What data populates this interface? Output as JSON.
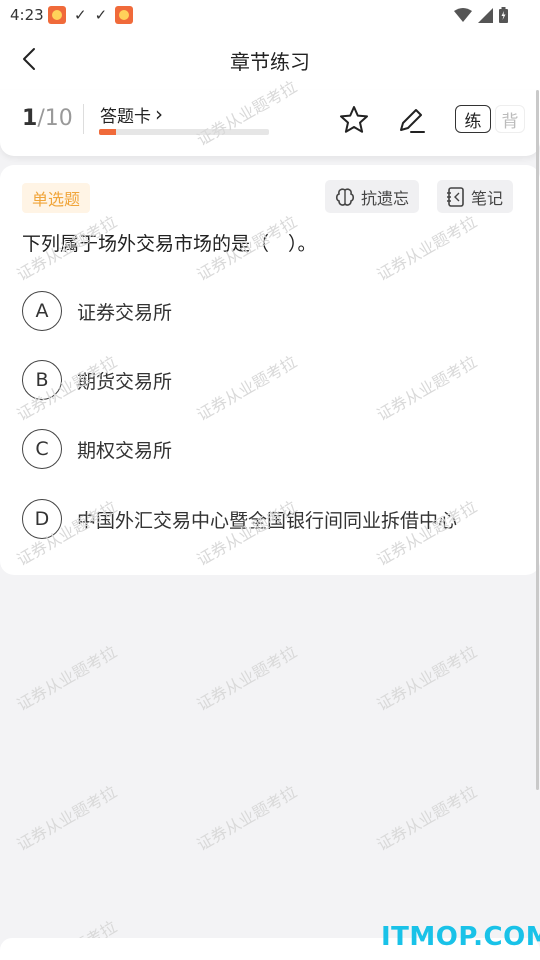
{
  "status_bar": {
    "time": "4:23",
    "notification_icons": [
      "app-icon",
      "download-done-icon",
      "download-done-icon",
      "app-icon"
    ],
    "system_icons": [
      "wifi-icon",
      "signal-icon",
      "battery-icon"
    ]
  },
  "header": {
    "title": "章节练习",
    "back_icon": "chevron-left-icon"
  },
  "progress": {
    "current": "1",
    "total": "/10",
    "answer_card_label": "答题卡",
    "answer_card_arrow": "›",
    "progress_fraction": 0.1,
    "accent_color": "#f06a3a"
  },
  "toolbar": {
    "favorite_icon": "star-icon",
    "edit_icon": "pen-icon",
    "mode_practice": "练",
    "mode_recite": "背"
  },
  "question": {
    "type_label": "单选题",
    "anti_forget_label": "抗遗忘",
    "notes_label": "笔记",
    "text": "下列属于场外交易市场的是（　）。",
    "options": [
      {
        "letter": "A",
        "text": "证券交易所"
      },
      {
        "letter": "B",
        "text": "期货交易所"
      },
      {
        "letter": "C",
        "text": "期权交易所"
      },
      {
        "letter": "D",
        "text": "中国外汇交易中心暨全国银行间同业拆借中心"
      }
    ]
  },
  "watermark_text": "证券从业题考拉",
  "site_logo": "ITMOP.COM"
}
